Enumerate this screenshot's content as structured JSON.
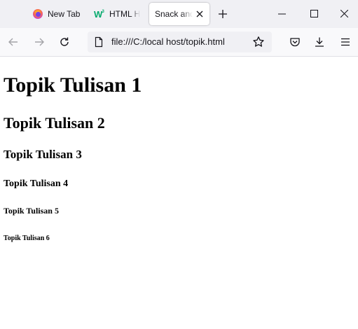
{
  "tabs": [
    {
      "label": "New Tab",
      "icon": "firefox-icon"
    },
    {
      "label": "HTML H",
      "icon": "w3schools-icon"
    },
    {
      "label": "Snack and",
      "icon": "none",
      "active": true
    }
  ],
  "toolbar": {
    "url": "file:///C:/local host/topik.html"
  },
  "page": {
    "h1": "Topik Tulisan 1",
    "h2": "Topik Tulisan 2",
    "h3": "Topik Tulisan 3",
    "h4": "Topik Tulisan 4",
    "h5": "Topik Tulisan 5",
    "h6": "Topik Tulisan 6"
  },
  "colors": {
    "tabstrip_bg": "#f0f0f4",
    "toolbar_bg": "#f9f9fb",
    "urlbar_bg": "#f0f0f4",
    "active_tab_bg": "#ffffff",
    "w3schools_green": "#04aa6d"
  }
}
